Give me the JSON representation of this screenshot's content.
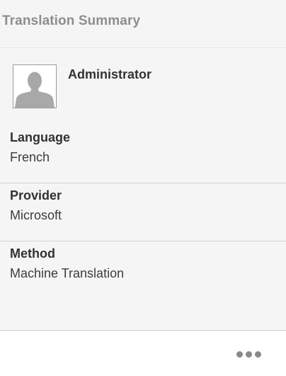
{
  "panel": {
    "title": "Translation Summary"
  },
  "user": {
    "name": "Administrator",
    "avatar_icon": "user-silhouette-icon"
  },
  "fields": {
    "language": {
      "label": "Language",
      "value": "French"
    },
    "provider": {
      "label": "Provider",
      "value": "Microsoft"
    },
    "method": {
      "label": "Method",
      "value": "Machine Translation"
    }
  },
  "footer": {
    "more_icon": "more-horizontal-icon"
  },
  "colors": {
    "panel_background": "#f5f5f5",
    "title_text": "#8e8e8e",
    "body_text": "#323232",
    "divider": "#d4d4d4",
    "more_dots": "#8a8a8a"
  }
}
